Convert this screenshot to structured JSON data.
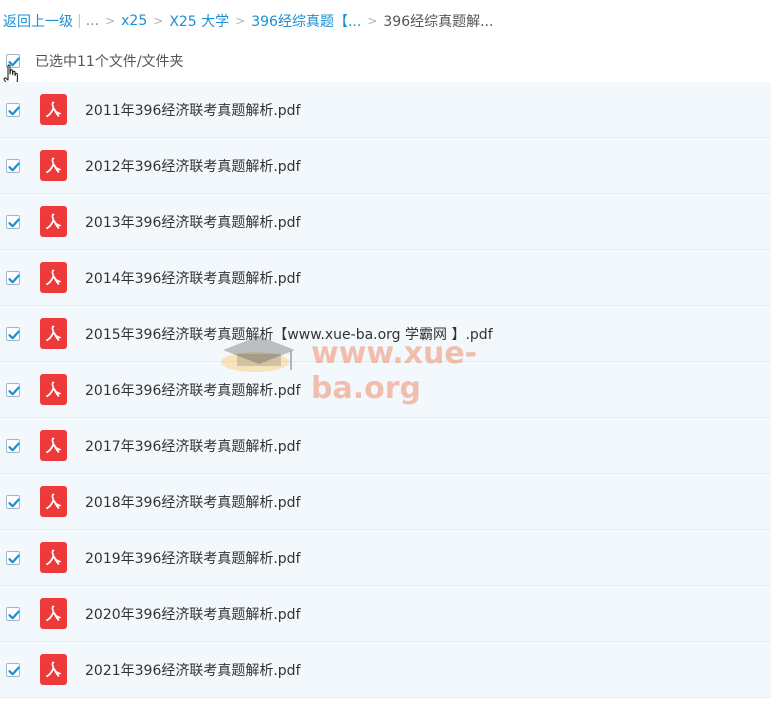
{
  "breadcrumb": {
    "back": "返回上一级",
    "ellipsis": "...",
    "items": [
      "x25",
      "X25 大学",
      "396经综真题【..."
    ],
    "current": "396经综真题解..."
  },
  "selection": {
    "text": "已选中11个文件/文件夹",
    "all_checked": true
  },
  "files": [
    {
      "name": "2011年396经济联考真题解析.pdf",
      "checked": true
    },
    {
      "name": "2012年396经济联考真题解析.pdf",
      "checked": true
    },
    {
      "name": "2013年396经济联考真题解析.pdf",
      "checked": true
    },
    {
      "name": "2014年396经济联考真题解析.pdf",
      "checked": true
    },
    {
      "name": "2015年396经济联考真题解析【www.xue-ba.org 学霸网 】.pdf",
      "checked": true
    },
    {
      "name": "2016年396经济联考真题解析.pdf",
      "checked": true
    },
    {
      "name": "2017年396经济联考真题解析.pdf",
      "checked": true
    },
    {
      "name": "2018年396经济联考真题解析.pdf",
      "checked": true
    },
    {
      "name": "2019年396经济联考真题解析.pdf",
      "checked": true
    },
    {
      "name": "2020年396经济联考真题解析.pdf",
      "checked": true
    },
    {
      "name": "2021年396经济联考真题解析.pdf",
      "checked": true
    }
  ],
  "watermark": "www.xue-ba.org",
  "colors": {
    "link": "#1a8fd6",
    "row_bg": "#f3f8fc",
    "check": "#1a8fd6",
    "pdf_icon": "#ee3a3a"
  }
}
